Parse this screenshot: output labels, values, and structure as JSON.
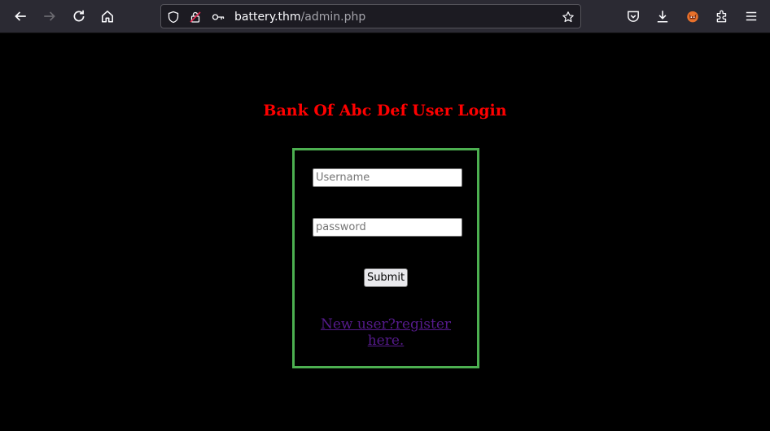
{
  "browser": {
    "url_host": "battery.thm",
    "url_path": "/admin.php"
  },
  "page": {
    "heading": "Bank Of Abc Def User Login",
    "username_placeholder": "Username",
    "password_placeholder": "password",
    "submit_label": "Submit",
    "register_link": "New user?register here."
  },
  "colors": {
    "heading": "#ff0000",
    "box_border": "#4caf50",
    "link": "#551a8b",
    "background": "#000000"
  }
}
